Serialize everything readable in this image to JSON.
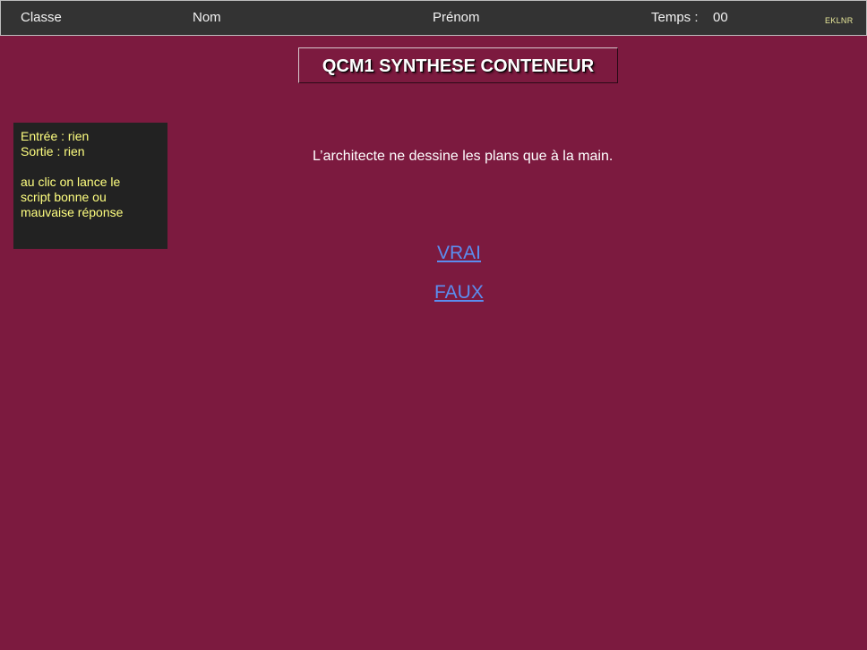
{
  "header": {
    "classe_label": "Classe",
    "nom_label": "Nom",
    "prenom_label": "Prénom",
    "temps_label": "Temps :",
    "temps_value": "00",
    "code": "EKLNR"
  },
  "title": "QCM1 SYNTHESE CONTENEUR",
  "note": {
    "line1": "Entrée : rien",
    "line2": "Sortie : rien",
    "line3": "au clic on lance le",
    "line4": "script bonne ou",
    "line5": "mauvaise réponse"
  },
  "question": "L’architecte ne dessine les plans que à la main.",
  "answers": {
    "true_label": "VRAI",
    "false_label": "FAUX"
  },
  "colors": {
    "background": "#7c1a3f",
    "header_bg": "#333333",
    "note_bg": "#222222",
    "note_text": "#ffff80",
    "link": "#5b8def"
  }
}
